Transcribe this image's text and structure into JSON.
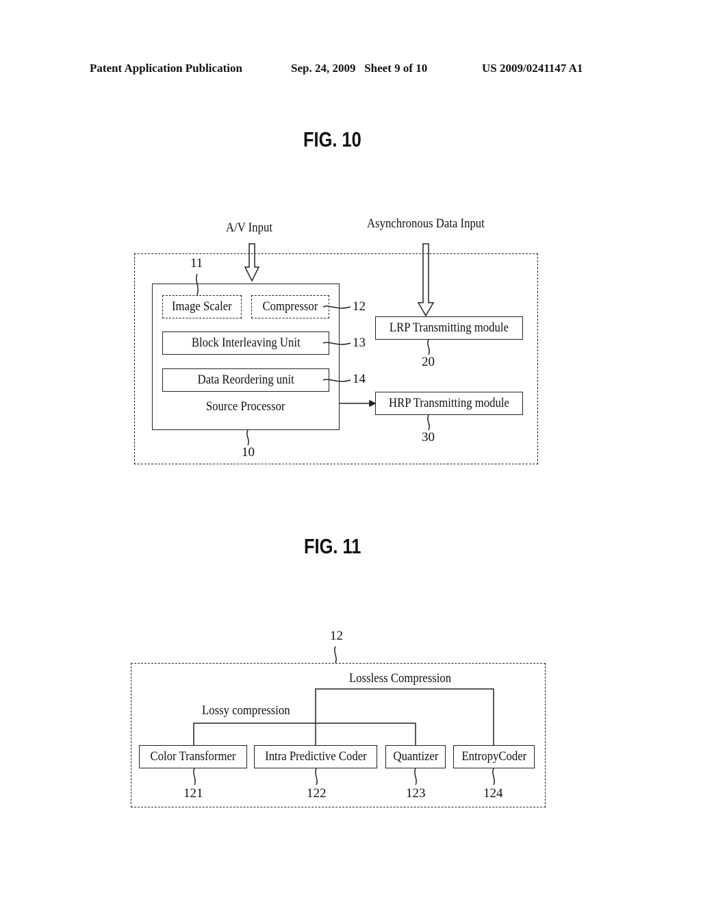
{
  "header": {
    "publication": "Patent Application Publication",
    "date_sheet": "Sep. 24, 2009   Sheet 9 of 10",
    "patent_number": "US 2009/0241147 A1"
  },
  "fig10": {
    "title": "FIG. 10",
    "inputs": {
      "av": "A/V Input",
      "async": "Asynchronous Data Input"
    },
    "source_processor": {
      "label": "Source Processor",
      "ref": "10",
      "units": [
        {
          "label": "Image Scaler",
          "ref": "11",
          "style": "dashed"
        },
        {
          "label": "Compressor",
          "ref": "12",
          "style": "dashed"
        },
        {
          "label": "Block Interleaving Unit",
          "ref": "13",
          "style": "solid"
        },
        {
          "label": "Data Reordering unit",
          "ref": "14",
          "style": "solid"
        }
      ]
    },
    "modules": [
      {
        "label": "LRP Transmitting module",
        "ref": "20"
      },
      {
        "label": "HRP Transmitting module",
        "ref": "30"
      }
    ]
  },
  "fig11": {
    "title": "FIG. 11",
    "ref": "12",
    "groups": {
      "lossless": "Lossless Compression",
      "lossy": "Lossy compression"
    },
    "blocks": [
      {
        "label": "Color Transformer",
        "ref": "121"
      },
      {
        "label": "Intra Predictive Coder",
        "ref": "122"
      },
      {
        "label": "Quantizer",
        "ref": "123"
      },
      {
        "label": "EntropyCoder",
        "ref": "124"
      }
    ]
  }
}
